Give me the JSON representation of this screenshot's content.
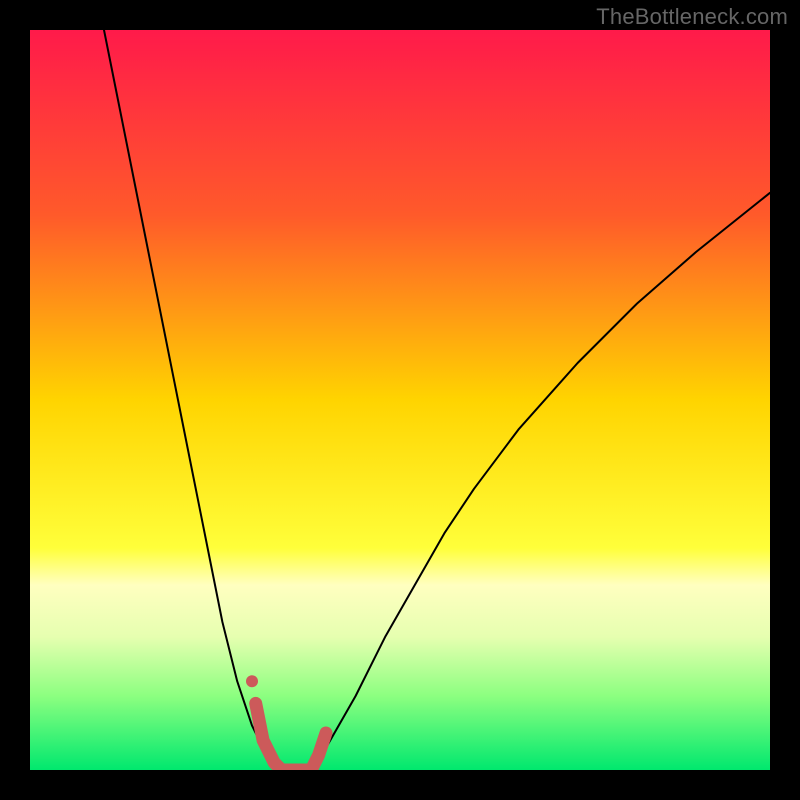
{
  "watermark": "TheBottleneck.com",
  "chart_data": {
    "type": "line",
    "title": "",
    "xlabel": "",
    "ylabel": "",
    "xlim": [
      0,
      100
    ],
    "ylim": [
      0,
      100
    ],
    "gradient_stops": [
      {
        "offset": 0,
        "color": "#ff1a4a"
      },
      {
        "offset": 25,
        "color": "#ff5a2a"
      },
      {
        "offset": 50,
        "color": "#ffd400"
      },
      {
        "offset": 70,
        "color": "#ffff3a"
      },
      {
        "offset": 75,
        "color": "#ffffc0"
      },
      {
        "offset": 82,
        "color": "#e6ffb0"
      },
      {
        "offset": 90,
        "color": "#8cff80"
      },
      {
        "offset": 100,
        "color": "#00e86e"
      }
    ],
    "series": [
      {
        "name": "left-curve",
        "stroke": "#000000",
        "stroke_width": 2,
        "x": [
          10,
          12,
          14,
          16,
          18,
          20,
          22,
          24,
          26,
          28,
          30,
          32,
          33
        ],
        "y": [
          100,
          90,
          80,
          70,
          60,
          50,
          40,
          30,
          20,
          12,
          6,
          2,
          0
        ]
      },
      {
        "name": "right-curve",
        "stroke": "#000000",
        "stroke_width": 2,
        "x": [
          38,
          40,
          44,
          48,
          52,
          56,
          60,
          66,
          74,
          82,
          90,
          100
        ],
        "y": [
          0,
          3,
          10,
          18,
          25,
          32,
          38,
          46,
          55,
          63,
          70,
          78
        ]
      },
      {
        "name": "marker-path",
        "stroke": "#cc5a5a",
        "stroke_width": 13,
        "x": [
          30.5,
          31.5,
          33,
          34,
          36,
          38,
          39,
          40
        ],
        "y": [
          9,
          4,
          1,
          0,
          0,
          0,
          2,
          5
        ]
      }
    ],
    "points": [
      {
        "name": "marker-dot",
        "x": 30,
        "y": 12,
        "r": 6,
        "fill": "#cc5a5a"
      }
    ]
  }
}
